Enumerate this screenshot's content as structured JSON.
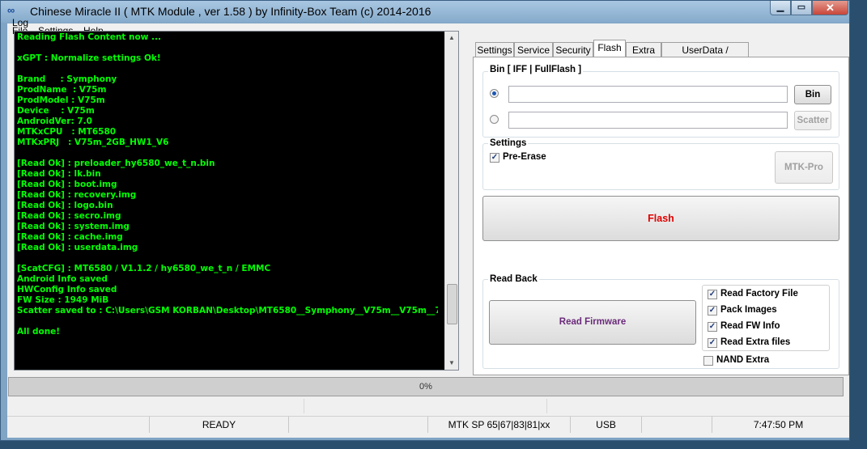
{
  "window": {
    "title": "Chinese Miracle II ( MTK Module , ver 1.58 ) by Infinity-Box Team (c) 2014-2016"
  },
  "menu": {
    "file": "File",
    "settings": "Settings",
    "help": "Help"
  },
  "log": {
    "label": "Log",
    "text": "Reading Flash Content now ...\n\nxGPT : Normalize settings Ok!\n\nBrand     : Symphony\nProdName  : V75m\nProdModel : V75m\nDevice    : V75m\nAndroidVer: 7.0\nMTKxCPU   : MT6580\nMTKxPRJ   : V75m_2GB_HW1_V6\n\n[Read Ok] : preloader_hy6580_we_t_n.bin\n[Read Ok] : lk.bin\n[Read Ok] : boot.img\n[Read Ok] : recovery.img\n[Read Ok] : logo.bin\n[Read Ok] : secro.img\n[Read Ok] : system.img\n[Read Ok] : cache.img\n[Read Ok] : userdata.img\n\n[ScatCFG] : MT6580 / V1.1.2 / hy6580_we_t_n / EMMC\nAndroid Info saved\nHWConfig Info saved\nFW Size : 1949 MiB\nScatter saved to : C:\\Users\\GSM KORBAN\\Desktop\\MT6580__Symphony__V75m__V75m__7\n\nAll done!"
  },
  "tabs": {
    "settings": "Settings",
    "service": "Service",
    "security": "Security",
    "flash": "Flash",
    "extra": "Extra",
    "userdata": "UserData / Forensic"
  },
  "flash": {
    "bin_group": "Bin  [ IFF | FullFlash ]",
    "bin_button": "Bin",
    "scatter_button": "Scatter",
    "settings_group": "Settings",
    "pre_erase": "Pre-Erase",
    "mtk_pro_button": "MTK-Pro",
    "flash_button": "Flash",
    "flash_color": "#e00000",
    "readback_group": "Read Back",
    "read_firmware_button": "Read Firmware",
    "read_firmware_color": "#6a2a7a",
    "read_factory_file": "Read Factory File",
    "pack_images": "Pack Images",
    "read_fw_info": "Read FW Info",
    "read_extra_files": "Read Extra files",
    "nand_extra": "NAND Extra"
  },
  "progress": {
    "text": "0%",
    "fraction": 0
  },
  "status": {
    "state": "READY",
    "protocol": "MTK SP 65|67|83|81|xx",
    "connection": "USB",
    "time": "7:47:50 PM"
  }
}
